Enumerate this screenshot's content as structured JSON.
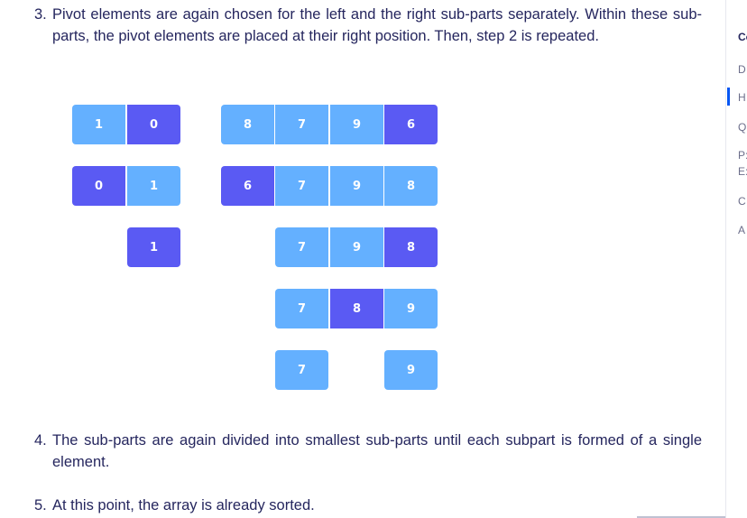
{
  "steps": [
    {
      "number": "3.",
      "text": "Pivot elements are again chosen for the left and the right sub-parts separately. Within these sub-parts, the pivot elements are placed at their right position. Then, step 2 is repeated."
    },
    {
      "number": "4.",
      "text": "The sub-parts are again divided into smallest sub-parts until each subpart is formed of a single element."
    },
    {
      "number": "5.",
      "text": "At this point, the array is already sorted."
    }
  ],
  "diagram": {
    "row1": {
      "left": [
        "1",
        "0"
      ],
      "right": [
        "8",
        "7",
        "9",
        "6"
      ]
    },
    "row2": {
      "left": [
        "0",
        "1"
      ],
      "right": [
        "6",
        "7",
        "9",
        "8"
      ]
    },
    "row3": {
      "left": [
        "1"
      ],
      "right": [
        "7",
        "9",
        "8"
      ]
    },
    "row4": {
      "right": [
        "7",
        "8",
        "9"
      ]
    },
    "row5": {
      "right": [
        "7",
        "9"
      ]
    }
  },
  "colors": {
    "element": "#64b0ff",
    "pivot": "#5a5af3",
    "text": "#25265e",
    "accent": "#0556f3"
  },
  "sidebar": {
    "title": "Co",
    "items": [
      "D",
      "H",
      "Q",
      "P:",
      "E:",
      "C",
      "A"
    ]
  }
}
